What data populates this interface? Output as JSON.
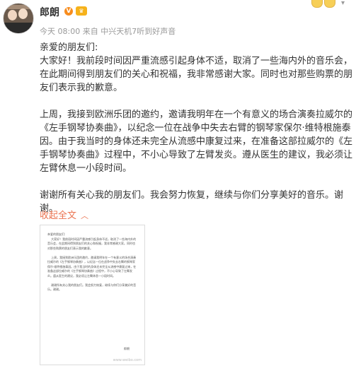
{
  "header": {
    "username": "郎朗",
    "verified_badge": "V",
    "member_badge": "♛",
    "timestamp": "今天 08:00",
    "source": "来自 中兴天机7听到好声音"
  },
  "post": {
    "text": "亲爱的朋友们:\n大家好！我前段时间因严重流感引起身体不适，取消了一些海内外的音乐会，在此期间得到朋友们的关心和祝福，我非常感谢大家。同时也对那些购票的朋友们表示我的歉意。\n\n上周，我接到欧洲乐团的邀约，邀请我明年在一个有意义的场合演奏拉威尔的《左手钢琴协奏曲》，以纪念一位在战争中失去右臂的钢琴家保尔·维特根施泰因。由于我当时的身体还未完全从流感中康复过来，在准备这部拉威尔的《左手钢琴协奏曲》过程中，不小心导致了左臂发炎。遵从医生的建议，我必须让左臂休息一小段时间。\n\n谢谢所有关心我的朋友们。我会努力恢复，继续与你们分享美好的音乐。谢谢。",
    "collapse_label": "收起全文",
    "collapse_caret": "︿"
  },
  "thumbnail": {
    "text": "亲爱的朋友们:\n    大家好！我前段时间因严重流感引起身体不适，取消了一些海内外的音乐会，在此期间得到朋友们的关心和祝福，我非常感谢大家。同时也对那些购票的朋友们表示我的歉意。\n\n    上周，我接到欧洲乐团的邀约，邀请我明年在一个有意义的场合演奏拉威尔的《左手钢琴协奏曲》，以纪念一位在战争中失去右臂的钢琴家保尔·维特根施泰因。由于我当时的身体还未完全从流感中康复过来，在准备这部拉威尔的《左手钢琴协奏曲》过程中，不小心导致了左臂发炎。遵从医生的建议，我必须让左臂休息一小段时间。\n\n    谢谢所有关心我的朋友们。我会努力恢复，继续与你们分享美好的音乐。谢谢。",
    "signature": "郎朗",
    "watermark": "www.weibo.com"
  },
  "colors": {
    "link": "#eb7350",
    "meta": "#999999",
    "text": "#333333"
  }
}
